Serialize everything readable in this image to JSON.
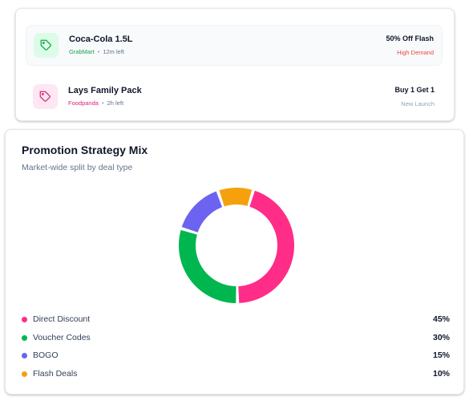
{
  "deals": [
    {
      "name": "Coca-Cola 1.5L",
      "platform": "GrabMart",
      "platform_color": "#16a34a",
      "separator": "•",
      "time_left": "12m left",
      "offer": "50% Off Flash",
      "tag": "High Demand",
      "tag_color": "#ef4444",
      "icon": "tag-icon",
      "icon_color": "#16a34a"
    },
    {
      "name": "Lays Family Pack",
      "platform": "Foodpanda",
      "platform_color": "#db2777",
      "separator": "•",
      "time_left": "2h left",
      "offer": "Buy 1 Get 1",
      "tag": "New Launch",
      "tag_color": "#94a3b8",
      "icon": "tag-icon",
      "icon_color": "#db2777"
    }
  ],
  "strategy": {
    "title": "Promotion Strategy Mix",
    "subtitle": "Market-wide split by deal type"
  },
  "chart_data": {
    "type": "pie",
    "donut": true,
    "categories": [
      "Direct Discount",
      "Voucher Codes",
      "BOGO",
      "Flash Deals"
    ],
    "values": [
      45,
      30,
      15,
      10
    ],
    "value_labels": [
      "45%",
      "30%",
      "15%",
      "10%"
    ],
    "colors": [
      "#ff2d87",
      "#00b64f",
      "#6c63f0",
      "#f5a10e"
    ],
    "legend": "bottom"
  }
}
